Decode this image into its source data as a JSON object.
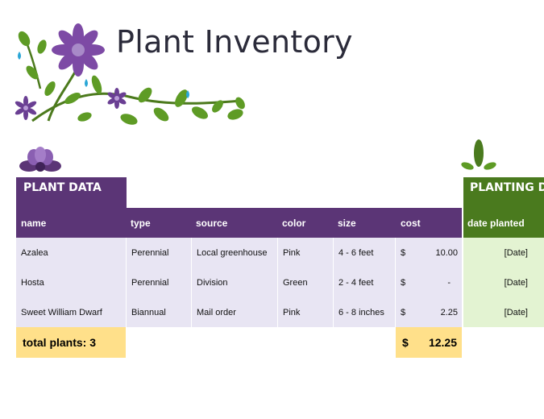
{
  "title": "Plant Inventory",
  "sections": {
    "plant_data_label": "PLANT DATA",
    "planting_label": "PLANTING DA"
  },
  "columns": [
    "name",
    "type",
    "source",
    "color",
    "size",
    "cost",
    "date planted"
  ],
  "rows": [
    {
      "name": "Azalea",
      "type": "Perennial",
      "source": "Local greenhouse",
      "color": "Pink",
      "size": "4 - 6 feet",
      "cur": "$",
      "cost": "10.00",
      "date": "[Date]"
    },
    {
      "name": "Hosta",
      "type": "Perennial",
      "source": "Division",
      "color": "Green",
      "size": "2 - 4 feet",
      "cur": "$",
      "cost": "-",
      "date": "[Date]"
    },
    {
      "name": "Sweet William Dwarf",
      "type": "Biannual",
      "source": "Mail order",
      "color": "Pink",
      "size": "6 - 8 inches",
      "cur": "$",
      "cost": "2.25",
      "date": "[Date]"
    }
  ],
  "totals": {
    "plants_label": "total plants: 3",
    "currency": "$",
    "cost": "12.25"
  },
  "colors": {
    "purple": "#5b3576",
    "green": "#4a7a1e",
    "row_purple": "#e8e5f3",
    "row_green": "#e3f3d2",
    "total_yellow": "#ffe08a"
  }
}
